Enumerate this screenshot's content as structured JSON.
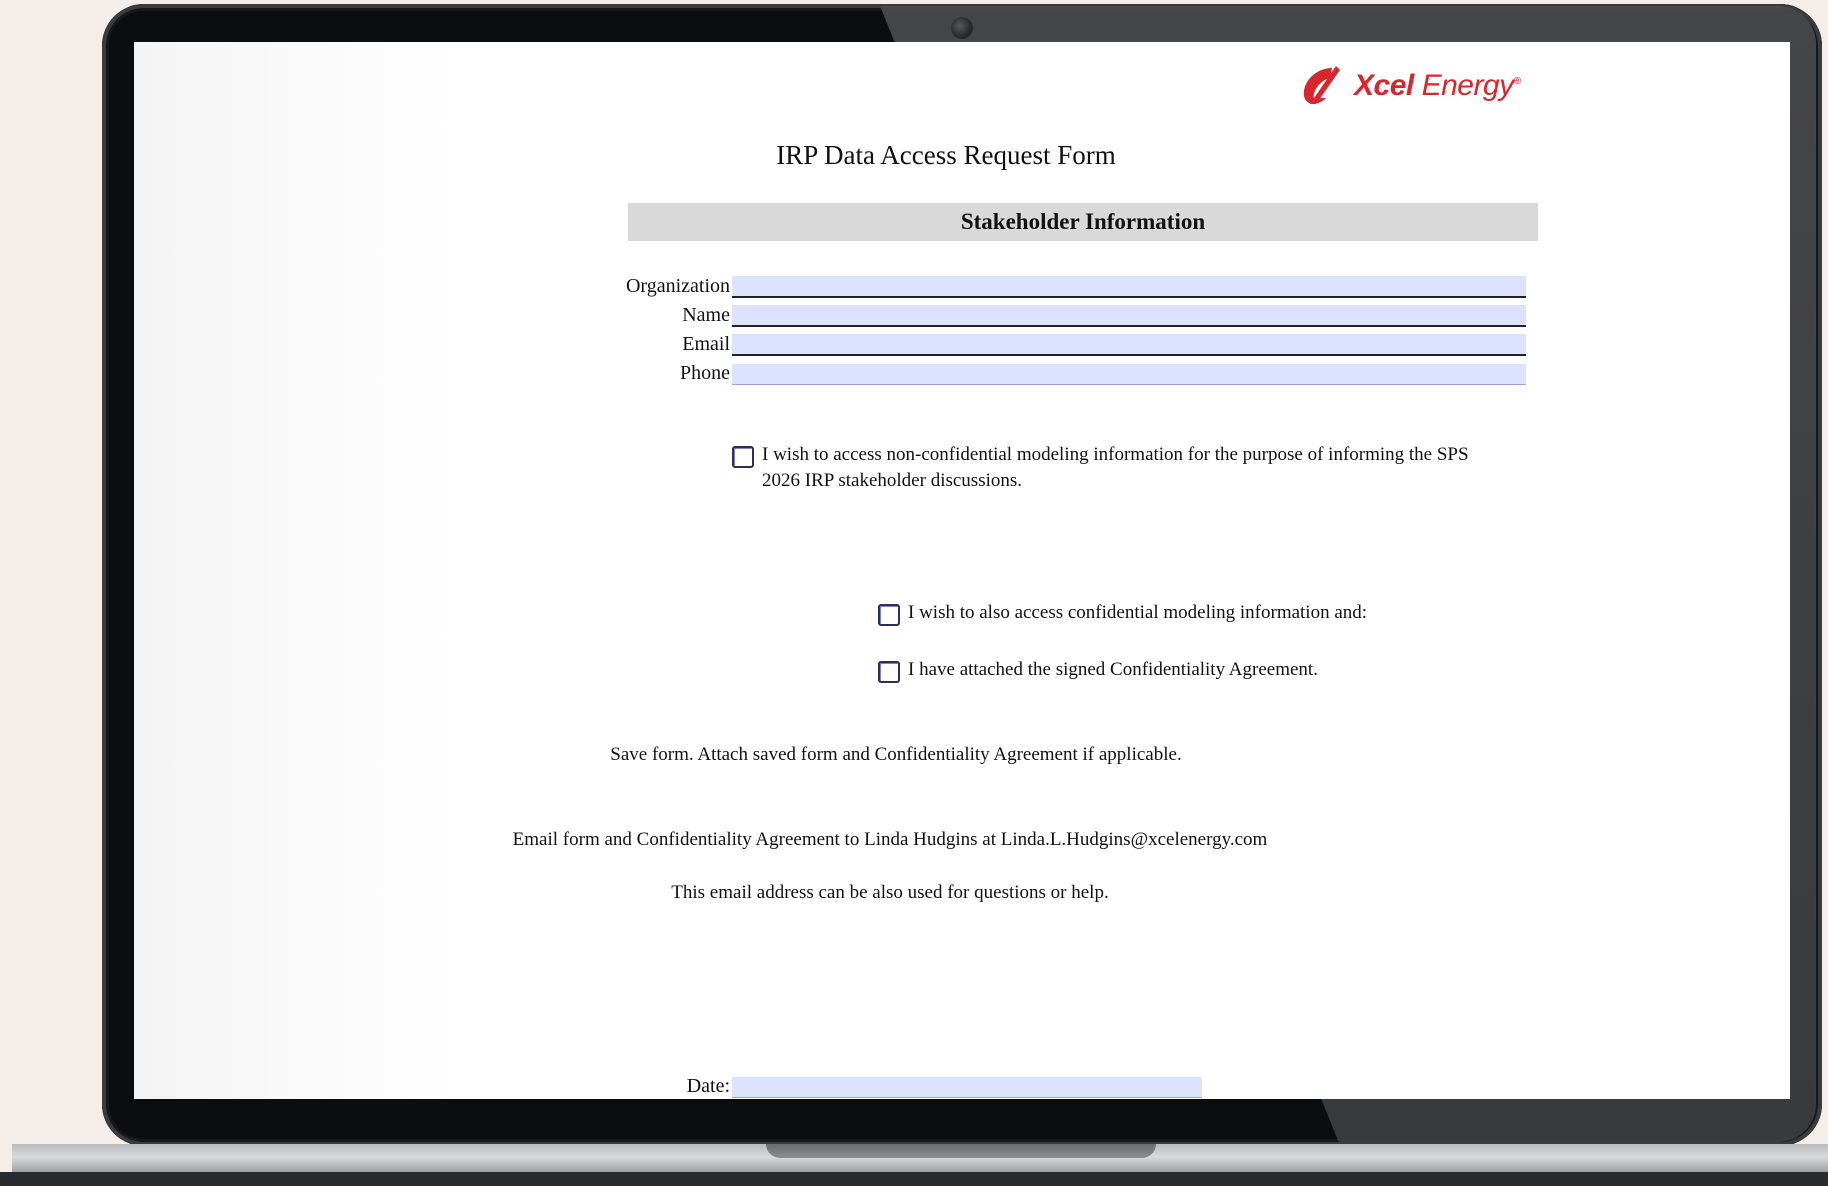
{
  "logo": {
    "brand_bold": "Xcel",
    "brand_light": "Energy",
    "trademark": "®"
  },
  "form": {
    "title": "IRP Data Access Request Form",
    "section_header": "Stakeholder Information",
    "fields": [
      {
        "label": "Organization",
        "value": ""
      },
      {
        "label": "Name",
        "value": ""
      },
      {
        "label": "Email",
        "value": ""
      },
      {
        "label": "Phone",
        "value": ""
      }
    ],
    "checkboxes": [
      {
        "label_line1": "I wish to access non-confidential modeling information for the purpose of informing the SPS",
        "label_line2": "2026 IRP stakeholder discussions.",
        "checked": false
      },
      {
        "label": "I wish to also access confidential modeling information and:",
        "checked": false
      },
      {
        "label": "I have attached the signed Confidentiality Agreement.",
        "checked": false
      }
    ],
    "instructions": {
      "save": "Save form. Attach saved form and Confidentiality Agreement if applicable.",
      "email": "Email form and Confidentiality Agreement to Linda Hudgins at Linda.L.Hudgins@xcelenergy.com",
      "help": "This email address can be also used for questions or help."
    },
    "date": {
      "label": "Date:",
      "value": ""
    }
  },
  "colors": {
    "brand_red": "#d7262e",
    "field_fill": "#dde3ff",
    "section_bar": "#d9d9d9"
  }
}
